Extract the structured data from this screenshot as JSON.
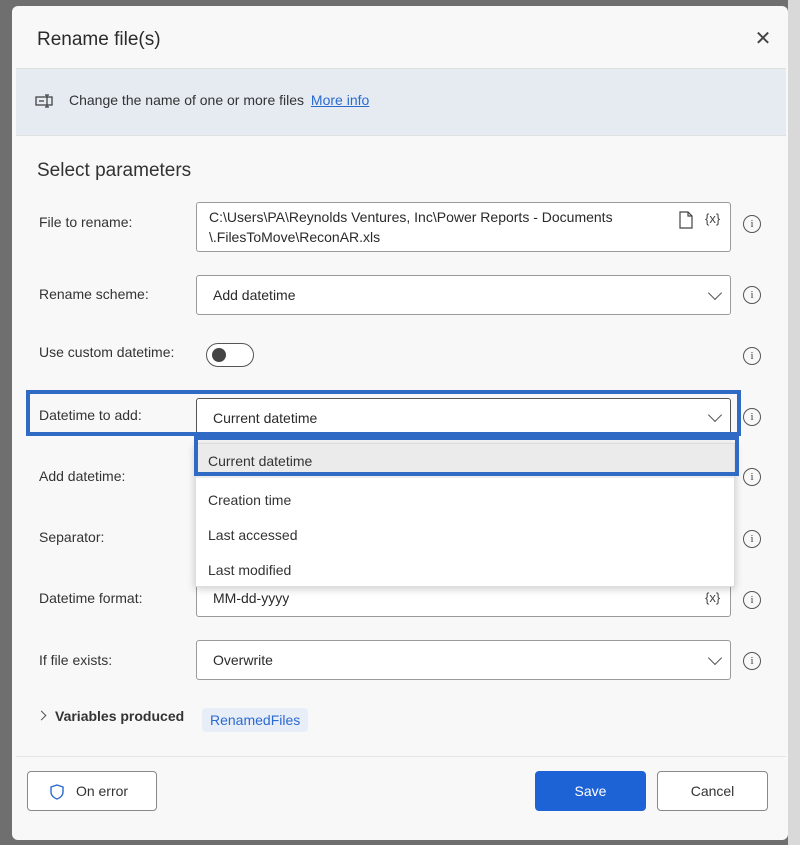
{
  "dialog": {
    "title": "Rename file(s)",
    "close_glyph": "✕",
    "info_text": "Change the name of one or more files",
    "more_info": "More info",
    "section_title": "Select parameters"
  },
  "fields": {
    "file_to_rename": {
      "label": "File to rename:",
      "value_line1": "C:\\Users\\PA\\Reynolds Ventures, Inc\\Power Reports - Documents",
      "value_line2": "\\.FilesToMove\\ReconAR.xls",
      "var_glyph": "{x}"
    },
    "rename_scheme": {
      "label": "Rename scheme:",
      "value": "Add datetime"
    },
    "use_custom_datetime": {
      "label": "Use custom datetime:",
      "state": "off"
    },
    "datetime_to_add": {
      "label": "Datetime to add:",
      "value": "Current datetime",
      "options": [
        "Current datetime",
        "Creation time",
        "Last accessed",
        "Last modified"
      ]
    },
    "add_datetime": {
      "label": "Add datetime:"
    },
    "separator": {
      "label": "Separator:"
    },
    "datetime_format": {
      "label": "Datetime format:",
      "value": "MM-dd-yyyy",
      "var_glyph": "{x}"
    },
    "if_file_exists": {
      "label": "If file exists:",
      "value": "Overwrite"
    }
  },
  "variables": {
    "label": "Variables produced",
    "tag": "RenamedFiles"
  },
  "footer": {
    "on_error": "On error",
    "save": "Save",
    "cancel": "Cancel"
  },
  "colors": {
    "accent": "#1e63d6",
    "highlight": "#2f6bc4",
    "link": "#2b6acf"
  }
}
